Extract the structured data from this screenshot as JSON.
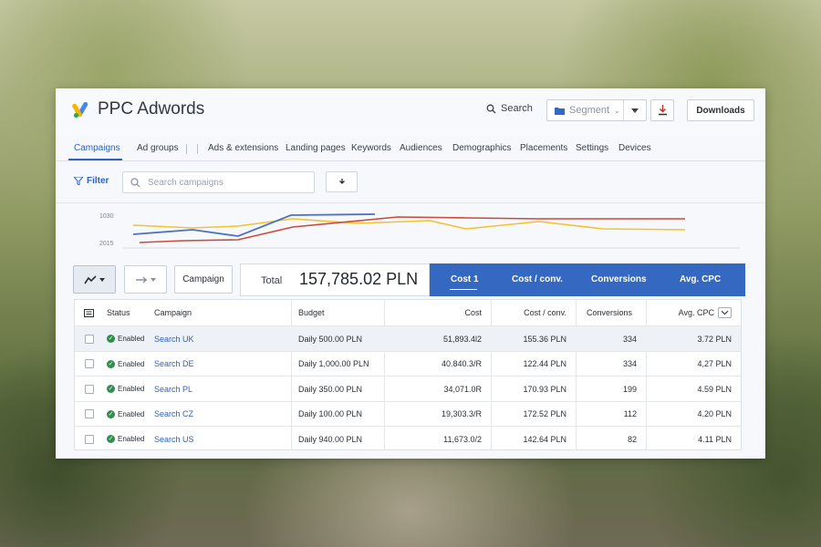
{
  "header": {
    "title": "PPC Adwords",
    "search_label": "Search",
    "segment_label": "Segment",
    "downloads_label": "Downloads"
  },
  "nav": {
    "tabs": [
      "Campaigns",
      "Ad groups",
      "Ads & extensions",
      "Landing pages",
      "Keywords",
      "Audiences",
      "Demographics",
      "Placements",
      "Settings",
      "Devices"
    ]
  },
  "toolbar": {
    "filter_label": "Filter",
    "search_placeholder": "Search campaigns"
  },
  "chart": {
    "y_ticks": [
      "1030",
      "2015"
    ]
  },
  "summary": {
    "campaign_button": "Campaign",
    "total_label": "Total",
    "total_value": "157,785.02 PLN",
    "metrics": [
      "Cost 1",
      "Cost / conv.",
      "Conversions",
      "Avg. CPC"
    ]
  },
  "table": {
    "headers": {
      "status": "Status",
      "campaign": "Campaign",
      "budget": "Budget",
      "cost": "Cost",
      "cost_conv": "Cost / conv.",
      "conversions": "Conversions",
      "avg_cpc": "Avg. CPC"
    },
    "rows": [
      {
        "status": "Enabled",
        "campaign": "Search UK",
        "budget": "Daily 500.00 PLN",
        "cost": "51,893.4l2",
        "cost_conv": "155.36 PLN",
        "conversions": "334",
        "avg_cpc": "3.72 PLN"
      },
      {
        "status": "Enabled",
        "campaign": "Search DE",
        "budget": "Daily 1,000.00 PLN",
        "cost": "40.840.3/R",
        "cost_conv": "122.44 PLN",
        "conversions": "334",
        "avg_cpc": "4,27 PLN"
      },
      {
        "status": "Enabled",
        "campaign": "Search PL",
        "budget": "Daily 350.00 PLN",
        "cost": "34,071.0R",
        "cost_conv": "170.93 PLN",
        "conversions": "199",
        "avg_cpc": "4.59 PLN"
      },
      {
        "status": "Enabled",
        "campaign": "Search CZ",
        "budget": "Daily 100.00 PLN",
        "cost": "19,303.3/R",
        "cost_conv": "172.52 PLN",
        "conversions": "112",
        "avg_cpc": "4.20 PLN"
      },
      {
        "status": "Enabled",
        "campaign": "Search US",
        "budget": "Daily 940.00 PLN",
        "cost": "11,673.0/2",
        "cost_conv": "142.64 PLN",
        "conversions": "82",
        "avg_cpc": "4.11 PLN"
      }
    ]
  },
  "colors": {
    "accent": "#3568c0",
    "link": "#2f62b8",
    "enabled": "#2f8f4e",
    "series_blue": "#4a72c4",
    "series_red": "#c94b3c",
    "series_yellow": "#f2c230"
  }
}
